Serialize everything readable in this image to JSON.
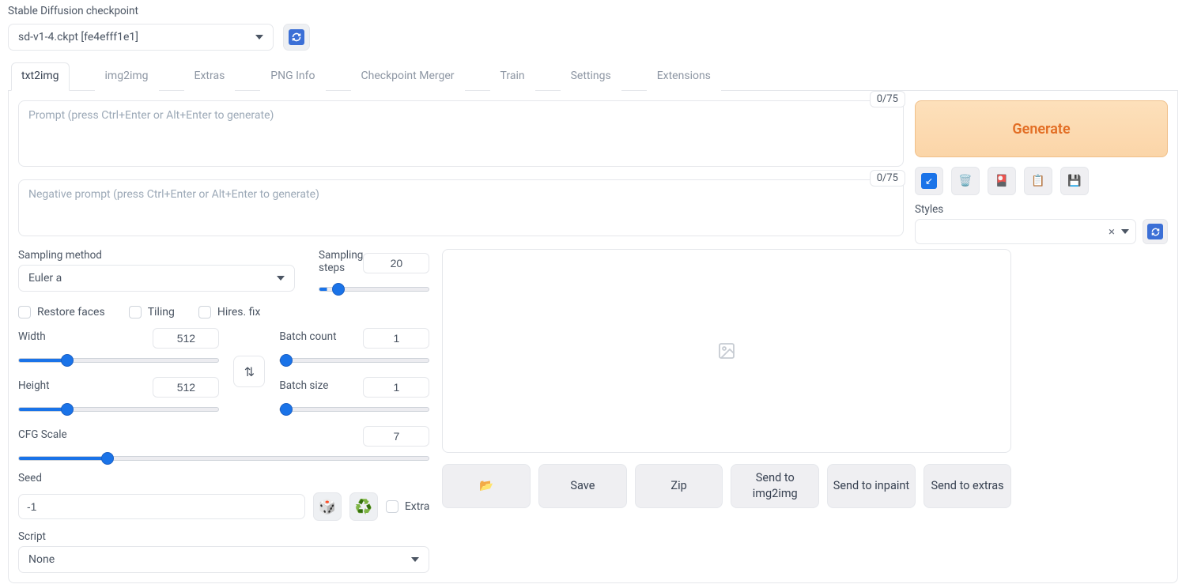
{
  "header": {
    "checkpointLabel": "Stable Diffusion checkpoint",
    "checkpointValue": "sd-v1-4.ckpt [fe4efff1e1]"
  },
  "tabs": [
    "txt2img",
    "img2img",
    "Extras",
    "PNG Info",
    "Checkpoint Merger",
    "Train",
    "Settings",
    "Extensions"
  ],
  "activeTab": "txt2img",
  "prompt": {
    "placeholder": "Prompt (press Ctrl+Enter or Alt+Enter to generate)",
    "counter": "0/75"
  },
  "negPrompt": {
    "placeholder": "Negative prompt (press Ctrl+Enter or Alt+Enter to generate)",
    "counter": "0/75"
  },
  "sampling": {
    "methodLabel": "Sampling method",
    "methodValue": "Euler a",
    "stepsLabel": "Sampling steps",
    "stepsValue": "20"
  },
  "checks": {
    "restoreFaces": "Restore faces",
    "tiling": "Tiling",
    "hiresFix": "Hires. fix"
  },
  "dims": {
    "widthLabel": "Width",
    "widthValue": "512",
    "heightLabel": "Height",
    "heightValue": "512",
    "batchCountLabel": "Batch count",
    "batchCountValue": "1",
    "batchSizeLabel": "Batch size",
    "batchSizeValue": "1"
  },
  "cfg": {
    "label": "CFG Scale",
    "value": "7"
  },
  "seed": {
    "label": "Seed",
    "value": "-1",
    "extraLabel": "Extra"
  },
  "script": {
    "label": "Script",
    "value": "None"
  },
  "generateLabel": "Generate",
  "stylesLabel": "Styles",
  "outputButtons": {
    "folder": "",
    "save": "Save",
    "zip": "Zip",
    "sendImg2img": "Send to img2img",
    "sendInpaint": "Send to inpaint",
    "sendExtras": "Send to extras"
  }
}
